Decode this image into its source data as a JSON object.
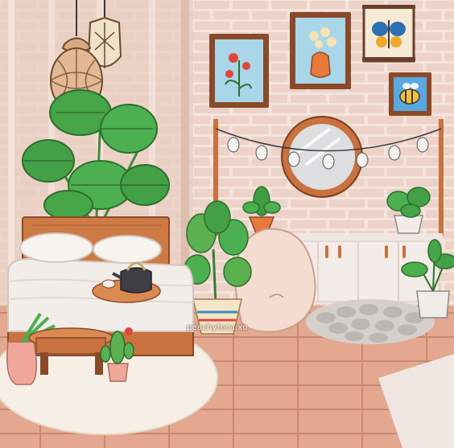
{
  "scene": {
    "watermark": "peachytoca.xo"
  },
  "icons": [
    "pendant-lamp-icon",
    "monstera-plant-icon",
    "string-lights-icon",
    "round-mirror-icon",
    "flower-painting-icon",
    "vase-painting-icon",
    "butterfly-poster-icon",
    "bee-painting-icon",
    "bed-icon",
    "teapot-icon",
    "cactus-icon",
    "fiddle-leaf-plant-icon",
    "bean-bag-icon",
    "pebble-mat-icon",
    "dresser-icon",
    "rug-icon"
  ],
  "colors": {
    "wall_brick": "#efd6cc",
    "floor": "#e5ad95",
    "wood": "#c9713f",
    "plant_green": "#3f9c3f",
    "rug": "#f6efe6",
    "bed_sheet": "#f2ede8"
  }
}
